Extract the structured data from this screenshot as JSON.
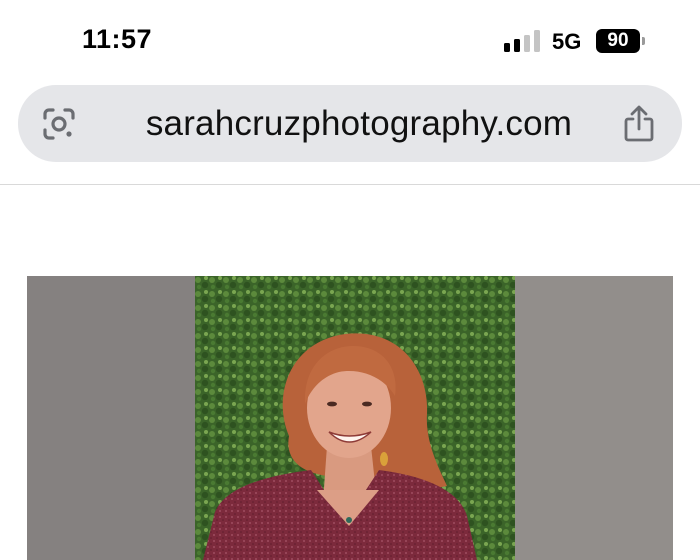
{
  "status_bar": {
    "time": "11:57",
    "network": "5G",
    "battery": "90",
    "signal_bars_active": 2,
    "signal_bars_total": 4
  },
  "browser": {
    "url": "sarahcruzphotography.com",
    "left_icon": "google-lens-icon",
    "right_icon": "share-icon"
  },
  "page": {
    "hero_image": {
      "subject": "portrait-photo",
      "colors": {
        "wall": "#8d8986",
        "hedge": "#3f6b2c",
        "hair": "#b8623a",
        "jacket": "#7c2a3c",
        "skin": "#e2a58c"
      }
    }
  }
}
